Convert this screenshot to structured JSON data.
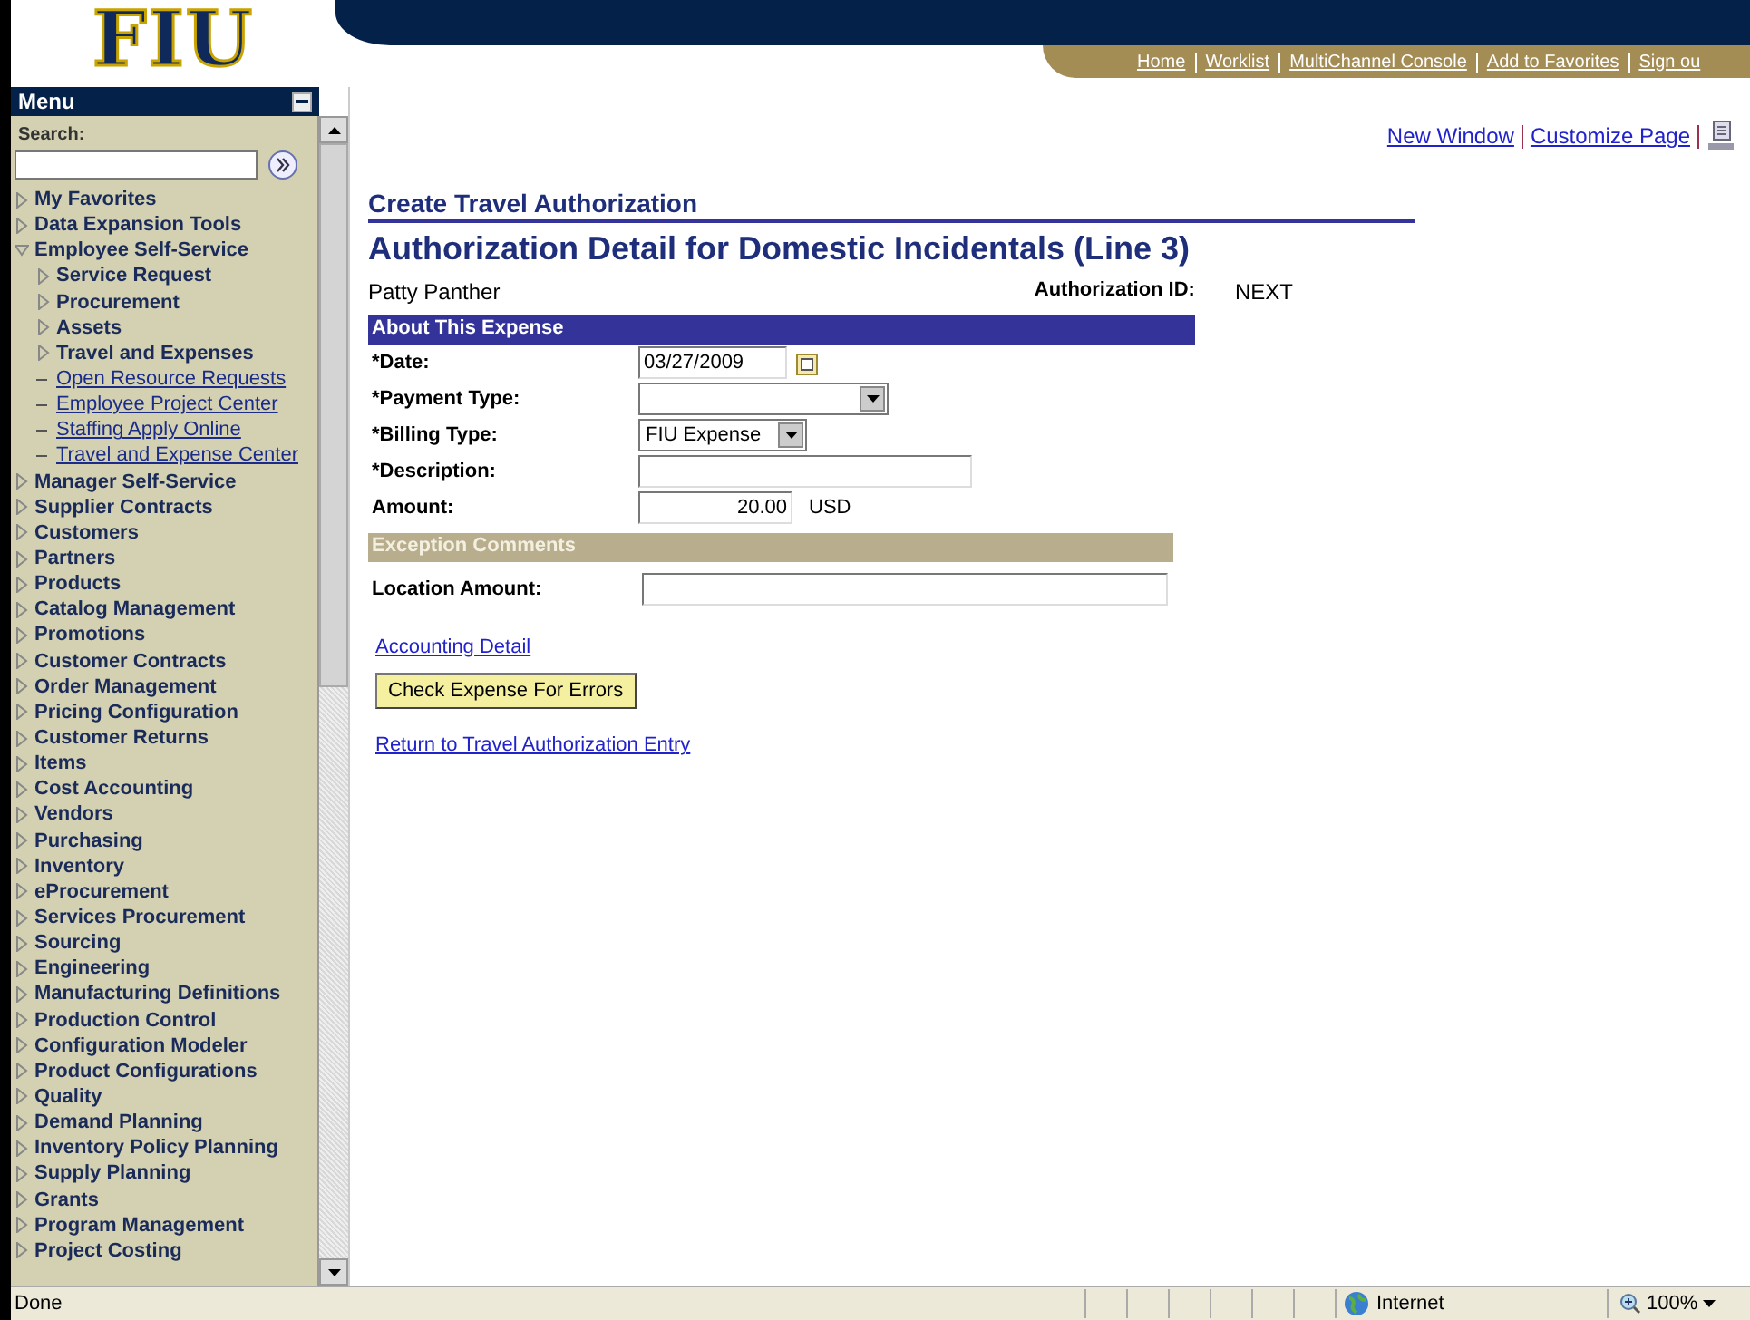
{
  "logo": {
    "text": "FIU"
  },
  "top_links": [
    "Home",
    "Worklist",
    "MultiChannel Console",
    "Add to Favorites",
    "Sign ou"
  ],
  "menu": {
    "title": "Menu",
    "search_label": "Search:",
    "items": [
      {
        "label": "My Favorites",
        "kind": "folder",
        "expanded": false
      },
      {
        "label": "Data Expansion Tools",
        "kind": "folder",
        "expanded": false
      },
      {
        "label": "Employee Self-Service",
        "kind": "folder",
        "expanded": true,
        "children": [
          {
            "label": "Service Request",
            "kind": "folder",
            "expanded": false
          },
          {
            "label": "Procurement",
            "kind": "folder",
            "expanded": false
          },
          {
            "label": "Assets",
            "kind": "folder",
            "expanded": false
          },
          {
            "label": "Travel and Expenses",
            "kind": "folder",
            "expanded": false
          },
          {
            "label": "Open Resource Requests",
            "kind": "link"
          },
          {
            "label": "Employee Project Center",
            "kind": "link"
          },
          {
            "label": "Staffing Apply Online",
            "kind": "link"
          },
          {
            "label": "Travel and Expense Center",
            "kind": "link"
          }
        ]
      },
      {
        "label": "Manager Self-Service",
        "kind": "folder",
        "expanded": false
      },
      {
        "label": "Supplier Contracts",
        "kind": "folder",
        "expanded": false
      },
      {
        "label": "Customers",
        "kind": "folder",
        "expanded": false
      },
      {
        "label": "Partners",
        "kind": "folder",
        "expanded": false
      },
      {
        "label": "Products",
        "kind": "folder",
        "expanded": false
      },
      {
        "label": "Catalog Management",
        "kind": "folder",
        "expanded": false
      },
      {
        "label": "Promotions",
        "kind": "folder",
        "expanded": false
      },
      {
        "label": "Customer Contracts",
        "kind": "folder",
        "expanded": false
      },
      {
        "label": "Order Management",
        "kind": "folder",
        "expanded": false
      },
      {
        "label": "Pricing Configuration",
        "kind": "folder",
        "expanded": false
      },
      {
        "label": "Customer Returns",
        "kind": "folder",
        "expanded": false
      },
      {
        "label": "Items",
        "kind": "folder",
        "expanded": false
      },
      {
        "label": "Cost Accounting",
        "kind": "folder",
        "expanded": false
      },
      {
        "label": "Vendors",
        "kind": "folder",
        "expanded": false
      },
      {
        "label": "Purchasing",
        "kind": "folder",
        "expanded": false
      },
      {
        "label": "Inventory",
        "kind": "folder",
        "expanded": false
      },
      {
        "label": "eProcurement",
        "kind": "folder",
        "expanded": false
      },
      {
        "label": "Services Procurement",
        "kind": "folder",
        "expanded": false
      },
      {
        "label": "Sourcing",
        "kind": "folder",
        "expanded": false
      },
      {
        "label": "Engineering",
        "kind": "folder",
        "expanded": false
      },
      {
        "label": "Manufacturing Definitions",
        "kind": "folder",
        "expanded": false
      },
      {
        "label": "Production Control",
        "kind": "folder",
        "expanded": false
      },
      {
        "label": "Configuration Modeler",
        "kind": "folder",
        "expanded": false
      },
      {
        "label": "Product Configurations",
        "kind": "folder",
        "expanded": false
      },
      {
        "label": "Quality",
        "kind": "folder",
        "expanded": false
      },
      {
        "label": "Demand Planning",
        "kind": "folder",
        "expanded": false
      },
      {
        "label": "Inventory Policy Planning",
        "kind": "folder",
        "expanded": false
      },
      {
        "label": "Supply Planning",
        "kind": "folder",
        "expanded": false
      },
      {
        "label": "Grants",
        "kind": "folder",
        "expanded": false
      },
      {
        "label": "Program Management",
        "kind": "folder",
        "expanded": false
      },
      {
        "label": "Project Costing",
        "kind": "folder",
        "expanded": false
      }
    ]
  },
  "page_links": [
    "New Window",
    "Customize Page"
  ],
  "breadcrumb": "Create Travel Authorization",
  "title": "Authorization Detail for Domestic Incidentals (Line 3)",
  "employee": "Patty Panther",
  "authorization_id": {
    "label": "Authorization ID:",
    "value": "NEXT"
  },
  "expense_section": {
    "title": "About This Expense",
    "fields": [
      {
        "label": "*Date:",
        "kind": "date",
        "value": "03/27/2009"
      },
      {
        "label": "*Payment Type:",
        "kind": "select"
      },
      {
        "label": "*Billing Type:",
        "kind": "select",
        "value": "FIU Expense"
      },
      {
        "label": "*Description:",
        "kind": "text"
      },
      {
        "label": "Amount:",
        "kind": "amount",
        "value": "20.00",
        "unit": "USD"
      }
    ]
  },
  "exception_section": {
    "title": "Exception Comments",
    "fields": [
      {
        "label": "Location Amount:",
        "kind": "text"
      }
    ]
  },
  "accounting_link": "Accounting Detail",
  "check_button": "Check Expense For Errors",
  "return_link": "Return to Travel Authorization Entry",
  "status_bar": {
    "text": "Done",
    "zone": "Internet",
    "zoom": "100%"
  }
}
